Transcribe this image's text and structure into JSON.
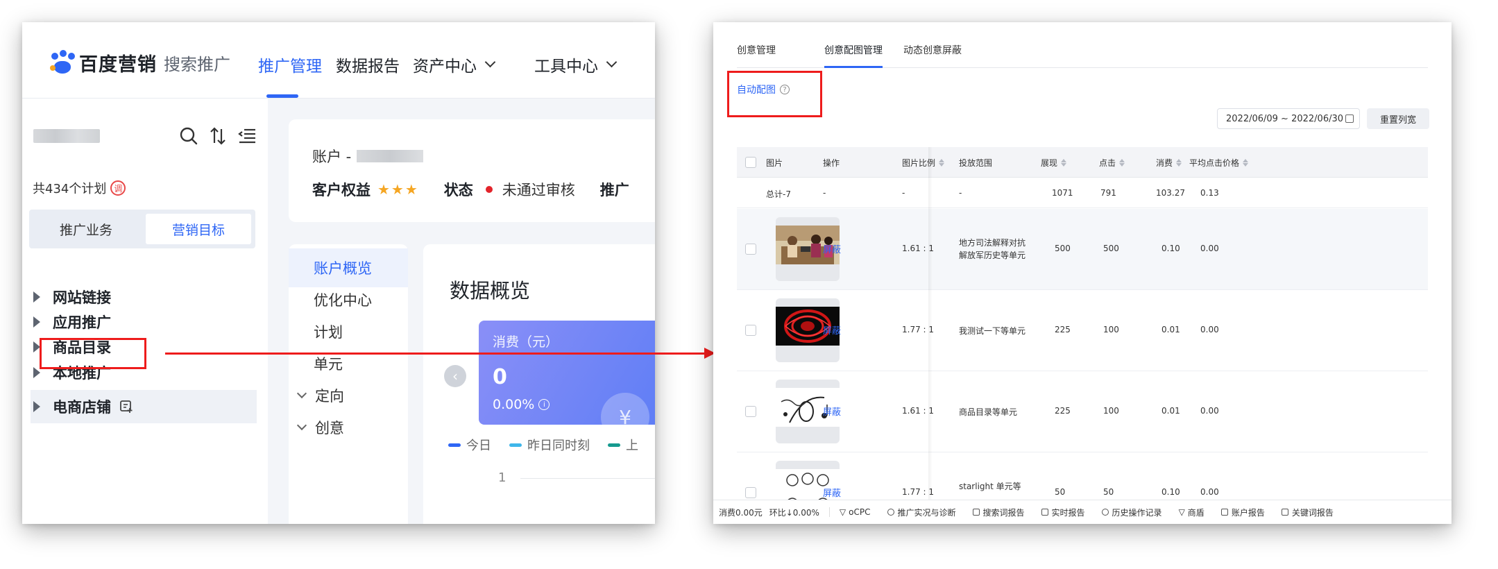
{
  "left": {
    "brand": {
      "name": "百度营销",
      "product": "搜索推广"
    },
    "top_nav": [
      "推广管理",
      "数据报告",
      "资产中心",
      "工具中心"
    ],
    "plan_count": "共434个计划",
    "plan_badge": "调",
    "segment": [
      "推广业务",
      "营销目标"
    ],
    "tree": [
      "网站链接",
      "应用推广",
      "商品目录",
      "本地推广",
      "电商店铺"
    ],
    "account": {
      "label": "账户 -",
      "rights_label": "客户权益",
      "stars": "★★★",
      "status_label": "状态",
      "status_value": "未通过审核",
      "promo_label": "推广"
    },
    "subnav": [
      "账户概览",
      "优化中心",
      "计划",
      "单元",
      "定向",
      "创意"
    ],
    "overview": {
      "title": "数据概览",
      "card_label": "消费（元）",
      "card_value": "0",
      "card_pct": "0.00%",
      "legend": [
        "今日",
        "昨日同时刻",
        "上"
      ],
      "axis_tick": "1"
    }
  },
  "right": {
    "tabs": [
      "创意管理",
      "创意配图管理",
      "动态创意屏蔽"
    ],
    "auto_image": "自动配图",
    "date_range": "2022/06/09 ~ 2022/06/30",
    "reset_button": "重置列宽",
    "columns": [
      "图片",
      "操作",
      "图片比例",
      "投放范围",
      "展现",
      "点击",
      "消费",
      "平均点击价格"
    ],
    "summary": [
      "总计-7",
      "-",
      "-",
      "-",
      "1071",
      "791",
      "103.27",
      "0.13"
    ],
    "rows": [
      {
        "action": "屏蔽",
        "ratio": "1.61 : 1",
        "scope": "地方司法解释对抗解放军历史等单元",
        "impressions": "500",
        "clicks": "500",
        "cost": "0.10",
        "avg_cpc": "0.00"
      },
      {
        "action": "屏蔽",
        "ratio": "1.77 : 1",
        "scope": "我测试一下等单元",
        "impressions": "225",
        "clicks": "100",
        "cost": "0.01",
        "avg_cpc": "0.00"
      },
      {
        "action": "屏蔽",
        "ratio": "1.61 : 1",
        "scope": "商品目录等单元",
        "impressions": "225",
        "clicks": "100",
        "cost": "0.01",
        "avg_cpc": "0.00"
      },
      {
        "action": "屏蔽",
        "ratio": "1.77 : 1",
        "scope": "starlight 单元等",
        "impressions": "50",
        "clicks": "50",
        "cost": "0.10",
        "avg_cpc": "0.00"
      }
    ],
    "status_bar": {
      "cost": "消费0.00元",
      "ratio": "环比↓0.00%",
      "items": [
        "oCPC",
        "推广实况与诊断",
        "搜索词报告",
        "实时报告",
        "历史操作记录",
        "商盾",
        "账户报告",
        "关键词报告"
      ]
    }
  },
  "colors": {
    "accent": "#2e66f5",
    "annotation": "#ee1c1c",
    "star": "#f5a623"
  }
}
